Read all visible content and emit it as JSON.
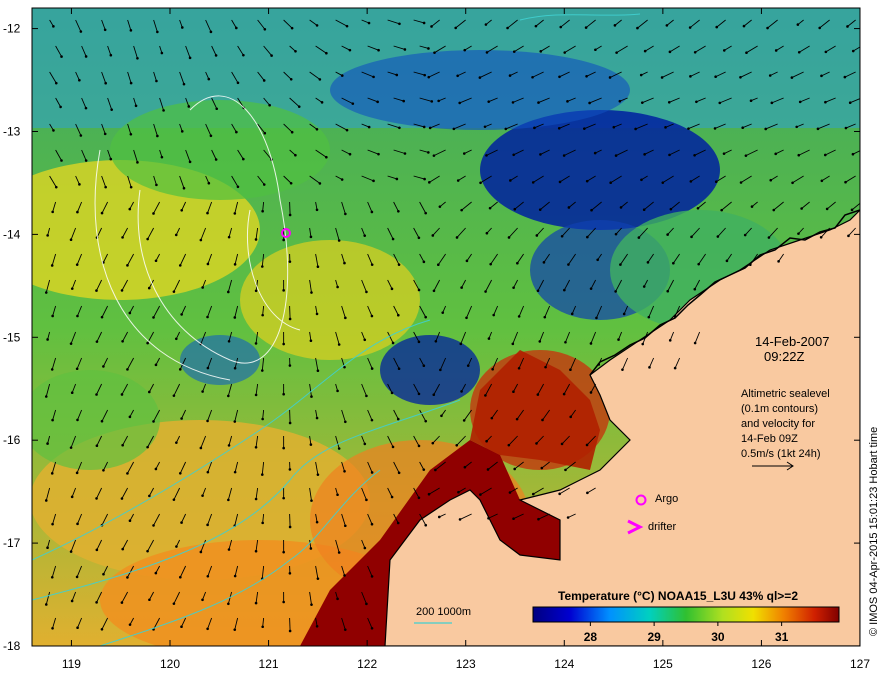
{
  "map": {
    "lon_ticks": [
      "119",
      "120",
      "121",
      "122",
      "123",
      "124",
      "125",
      "126",
      "127"
    ],
    "lat_ticks": [
      "-12",
      "-13",
      "-14",
      "-15",
      "-16",
      "-17",
      "-18"
    ],
    "lon_range": [
      118.6,
      127.0
    ],
    "lat_range": [
      -18.0,
      -11.8
    ]
  },
  "annotation": {
    "date": "14-Feb-2007",
    "time": "09:22Z",
    "altimetry_lines": [
      "Altimetric sealevel",
      "(0.1m contours)",
      "and velocity for",
      "14-Feb 09Z",
      "0.5m/s (1kt 24h)"
    ]
  },
  "legend": {
    "argo_label": "Argo",
    "drifter_label": "drifter",
    "bathy_label": "200  1000m"
  },
  "colorbar": {
    "title": "Temperature (°C) NOAA15_L3U 43% ql>=2",
    "ticks": [
      "28",
      "29",
      "30",
      "31"
    ],
    "tick_values": [
      28,
      29,
      30,
      31
    ],
    "range": [
      27.1,
      31.9
    ]
  },
  "credit": "© IMOS 04-Apr-2015 15:01:23 Hobart time",
  "markers": {
    "argo_positions": [
      [
        121.17,
        -13.9
      ],
      [
        124.8,
        -16.53
      ]
    ],
    "drifter_position": [
      124.8,
      -16.8
    ]
  },
  "colors": {
    "land": "#f9c9a0",
    "coast": "#000000",
    "contour_cyan": "#40d0d0",
    "argo": "#ff00ff"
  }
}
